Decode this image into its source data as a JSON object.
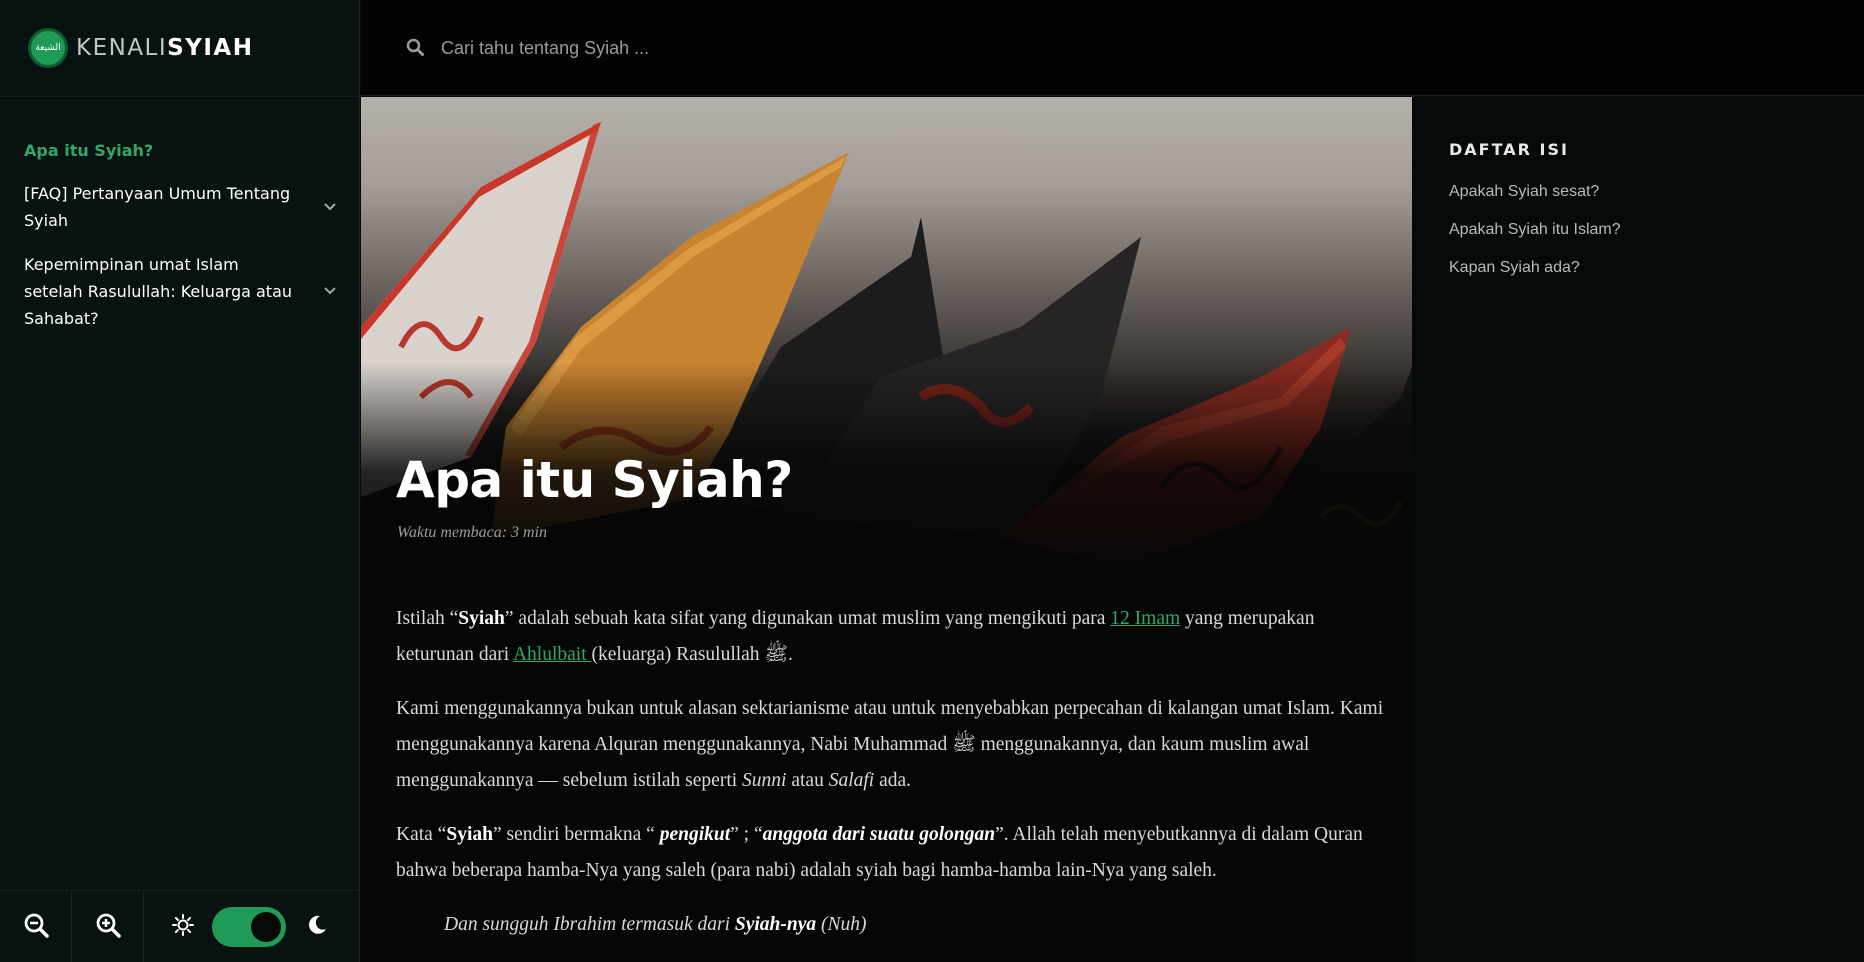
{
  "brand": {
    "name_light": "KENALI",
    "name_bold": "SYIAH",
    "badge_text": "الشيعة"
  },
  "search": {
    "placeholder": "Cari tahu tentang Syiah ..."
  },
  "sidebar": {
    "items": [
      {
        "label": "Apa itu Syiah?",
        "active": true
      },
      {
        "label": "[FAQ] Pertanyaan Umum Tentang Syiah",
        "active": false
      },
      {
        "label": "Kepemimpinan umat Islam setelah Rasulullah: Keluarga atau Sahabat?",
        "active": false
      }
    ]
  },
  "toolbar": {
    "zoom_out": "zoom-out-icon",
    "zoom_in": "zoom-in-icon",
    "light": "sun-icon",
    "dark": "moon-icon",
    "dark_mode_on": true
  },
  "article": {
    "title": "Apa itu Syiah?",
    "read_time": "Waktu membaca: 3 min",
    "p1_a": "Istilah “",
    "p1_b": "Syiah",
    "p1_c": "” adalah sebuah kata sifat yang digunakan umat muslim yang mengikuti para ",
    "p1_link1": "12 Imam",
    "p1_d": " yang meru­pakan keturunan dari ",
    "p1_link2": "Ahlulbait ",
    "p1_e": "(keluarga) Rasulullah ﷺ.",
    "p2_a": "Kami menggunakannya bukan untuk alasan sektarianisme atau untuk menyebabkan perpecahan di kalangan umat Islam. Kami menggunakannya karena Alquran menggunakannya, Nabi Muhammad ﷺ menggunakannya, dan kaum muslim awal menggunakannya — sebelum istilah seperti ",
    "p2_sunni": "Sunni",
    "p2_b": " atau ",
    "p2_salafi": "Salafi",
    "p2_c": " ada.",
    "p3_a": "Kata “",
    "p3_b": "Syiah",
    "p3_c": "” sendiri bermakna “ ",
    "p3_d": "pengikut",
    "p3_e": "” ; “",
    "p3_f": "anggota dari suatu golongan",
    "p3_g": "”.  Allah telah menyebutkannya di dalam Quran bahwa beberapa hamba-Nya yang saleh (para nabi) adalah syiah bagi hamba-hamba lain-Nya yang saleh.",
    "quote_a": "Dan sungguh Ibrahim termasuk dari ",
    "quote_b": "Syiah-nya",
    "quote_c": " (Nuh)"
  },
  "toc": {
    "title": "DAFTAR ISI",
    "items": [
      "Apakah Syiah sesat?",
      "Apakah Syiah itu Islam?",
      "Kapan Syiah ada?"
    ]
  },
  "colors": {
    "accent": "#2ea86a",
    "background": "#050908",
    "sidebar": "#081210"
  }
}
